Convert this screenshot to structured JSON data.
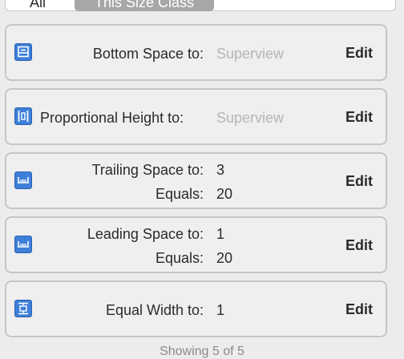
{
  "segmented": {
    "all_label": "All",
    "selected_label": "This Size Class"
  },
  "constraints": [
    {
      "label": "Bottom Space to:",
      "value": "Superview",
      "value_is_placeholder": true,
      "edit": "Edit",
      "icon": "bottom-space-icon"
    },
    {
      "label": "Proportional Height to:",
      "value": "Superview",
      "value_is_placeholder": true,
      "edit": "Edit",
      "icon": "proportional-height-icon"
    },
    {
      "label": "Trailing Space to:",
      "value": "3",
      "equals_label": "Equals:",
      "equals_value": "20",
      "edit": "Edit",
      "icon": "trailing-space-icon"
    },
    {
      "label": "Leading Space to:",
      "value": "1",
      "equals_label": "Equals:",
      "equals_value": "20",
      "edit": "Edit",
      "icon": "leading-space-icon"
    },
    {
      "label": "Equal Width to:",
      "value": "1",
      "edit": "Edit",
      "icon": "equal-width-icon"
    }
  ],
  "footer": "Showing 5 of 5",
  "colors": {
    "icon_blue": "#3d7fd9",
    "placeholder": "#b5b5b5",
    "card_border": "#c6c6c6"
  }
}
